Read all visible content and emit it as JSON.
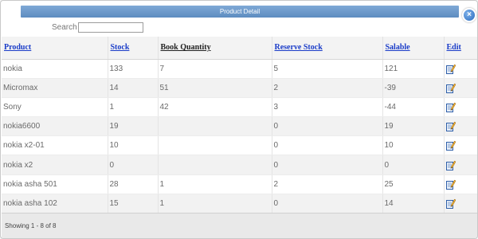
{
  "dialog": {
    "title": "Product Detail",
    "close_glyph": "×"
  },
  "search": {
    "label": "Search",
    "value": ""
  },
  "columns": [
    "Product",
    "Stock",
    "Book Quantity",
    "Reserve Stock",
    "Salable",
    "Edit"
  ],
  "rows": [
    {
      "product": "nokia",
      "stock": "133",
      "book_qty": "7",
      "reserve": "5",
      "salable": "121"
    },
    {
      "product": "Micromax",
      "stock": "14",
      "book_qty": "51",
      "reserve": "2",
      "salable": "-39"
    },
    {
      "product": "Sony",
      "stock": "1",
      "book_qty": "42",
      "reserve": "3",
      "salable": "-44"
    },
    {
      "product": "nokia6600",
      "stock": "19",
      "book_qty": "",
      "reserve": "0",
      "salable": "19"
    },
    {
      "product": "nokia x2-01",
      "stock": "10",
      "book_qty": "",
      "reserve": "0",
      "salable": "10"
    },
    {
      "product": "nokia x2",
      "stock": "0",
      "book_qty": "",
      "reserve": "0",
      "salable": "0"
    },
    {
      "product": "nokia asha 501",
      "stock": "28",
      "book_qty": "1",
      "reserve": "2",
      "salable": "25"
    },
    {
      "product": "nokia asha 102",
      "stock": "15",
      "book_qty": "1",
      "reserve": "0",
      "salable": "14"
    }
  ],
  "footer": {
    "status": "Showing 1 - 8 of 8"
  },
  "icons": {
    "edit": "edit-pencil-icon",
    "close": "close-icon"
  },
  "colors": {
    "titlebar": "#5d8cc0",
    "header_link": "#1a3cc8",
    "close_button": "#2a6bbf"
  }
}
